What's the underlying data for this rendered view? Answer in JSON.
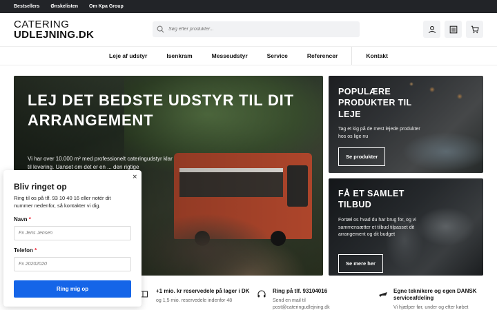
{
  "topbar": {
    "links": [
      "Bestsellers",
      "Ønskelisten",
      "Om Kpa Group"
    ]
  },
  "header": {
    "logo_line1": "CATERING",
    "logo_line2": "UDLEJNING.DK",
    "search_placeholder": "Søg efter produkter...",
    "icons": [
      "user-icon",
      "list-icon",
      "cart-icon"
    ]
  },
  "nav": {
    "items": [
      "Leje af udstyr",
      "Isenkram",
      "Messeudstyr",
      "Service",
      "Referencer",
      "Kontakt"
    ]
  },
  "hero": {
    "title": "LEJ DET BEDSTE UDSTYR TIL DIT ARRANGEMENT",
    "text": "Vi har over 10.000 m² med professionelt cateringudstyr klar til levering. Uanset om det er en ... den rigtige"
  },
  "cards": [
    {
      "title": "POPULÆRE PRODUKTER TIL LEJE",
      "text": "Tag et kig på de mest lejede produkter hos os lige nu",
      "button": "Se produkter"
    },
    {
      "title": "FÅ ET SAMLET TILBUD",
      "text": "Fortæl os hvad du har brug for, og vi sammensætter et tilbud tilpasset dit arrangement og dit budget",
      "button": "Se mere her"
    }
  ],
  "usps": [
    {
      "icon": "wrench-icon",
      "title": "+1 mio. kr reservedele på lager i DK",
      "sub": "og 1,5 mio. reservedele indenfor 48"
    },
    {
      "icon": "headset-icon",
      "title": "Ring på tlf. 93104016",
      "sub": "Send en mail til post@cateringudlejning.dk"
    },
    {
      "icon": "plane-icon",
      "title": "Egne teknikere og egen DANSK serviceafdeling",
      "sub": "Vi hjælper før, under og efter købet"
    }
  ],
  "popup": {
    "title": "Bliv ringet op",
    "desc": "Ring til os på tlf. 93 10 40 16 eller notér dit nummer nedenfor, så kontakter vi dig.",
    "name_label": "Navn",
    "name_placeholder": "Fx Jens Jensen",
    "phone_label": "Telefon",
    "phone_placeholder": "Fx 20202020",
    "required_mark": "*",
    "submit": "Ring mig op",
    "close": "×"
  },
  "colors": {
    "topbar": "#222428",
    "primary_button": "#1565e8",
    "required": "#ee2233"
  }
}
